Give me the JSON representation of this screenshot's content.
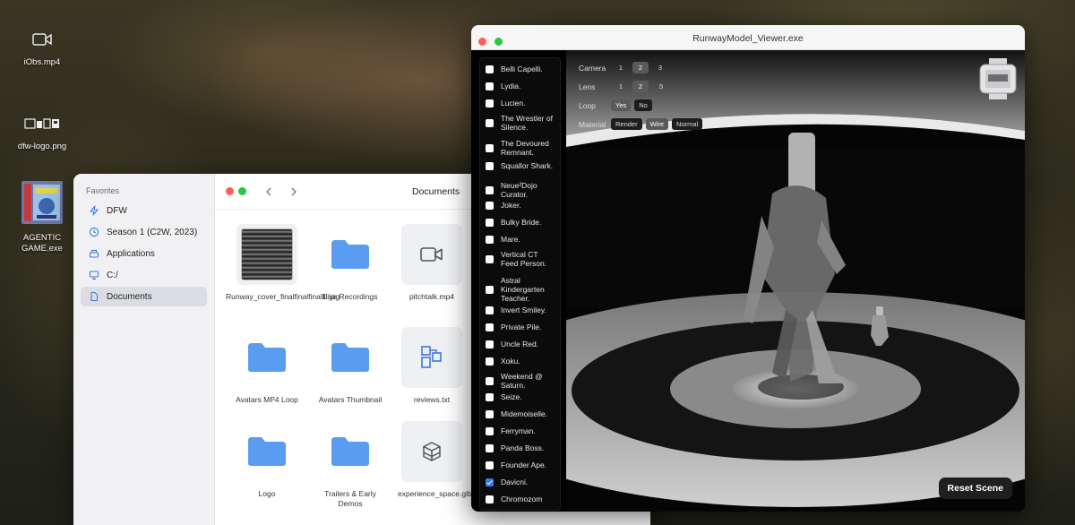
{
  "desktop": {
    "icons": [
      {
        "label": "iObs.mp4",
        "icon": "video-icon"
      },
      {
        "label": "dfw-logo.png",
        "icon": "logo-image-icon"
      },
      {
        "label": "AGENTIC GAME.exe",
        "icon": "game-cartridge-icon"
      }
    ]
  },
  "file_manager": {
    "sidebar_heading": "Favorites",
    "sidebar_items": [
      {
        "label": "DFW",
        "icon": "bolt-icon"
      },
      {
        "label": "Season 1 (C2W, 2023)",
        "icon": "clock-icon"
      },
      {
        "label": "Applications",
        "icon": "apps-icon"
      },
      {
        "label": "C:/",
        "icon": "monitor-icon"
      },
      {
        "label": "Documents",
        "icon": "document-icon",
        "active": true
      }
    ],
    "title": "Documents",
    "files": [
      {
        "label": "Runway_cover_finalfinalfinallll.jpg",
        "icon": "image-thumbnail"
      },
      {
        "label": "Live Recordings",
        "icon": "folder-icon"
      },
      {
        "label": "pitchtalk.mp4",
        "icon": "video-icon"
      },
      {
        "label": "Avatars MP4 Loop",
        "icon": "folder-icon"
      },
      {
        "label": "Avatars Thumbnail",
        "icon": "folder-icon"
      },
      {
        "label": "reviews.txt",
        "icon": "text-file-icon"
      },
      {
        "label": "Logo",
        "icon": "folder-icon"
      },
      {
        "label": "Trailers & Early Demos",
        "icon": "folder-icon"
      },
      {
        "label": "experience_space.glb",
        "icon": "3d-model-icon"
      }
    ]
  },
  "viewer": {
    "title": "RunwayModel_Viewer.exe",
    "characters": [
      {
        "label": "Belli Capelli.",
        "checked": false
      },
      {
        "label": "Lydia.",
        "checked": false
      },
      {
        "label": "Lucien.",
        "checked": false
      },
      {
        "label": "The Wrestler of Silence.",
        "checked": false
      },
      {
        "label": "The Devoured Remnant.",
        "checked": false
      },
      {
        "label": "Squallor Shark.",
        "checked": false
      },
      {
        "label": "Neue²Dojo Curator.",
        "checked": false
      },
      {
        "label": "Joker.",
        "checked": false
      },
      {
        "label": "Bulky Bride.",
        "checked": false
      },
      {
        "label": "Mare.",
        "checked": false
      },
      {
        "label": "Vertical CT Feed Person.",
        "checked": false
      },
      {
        "label": "Astral Kindergarten Teacher.",
        "checked": false
      },
      {
        "label": "Invert Smiley.",
        "checked": false
      },
      {
        "label": "Private Pile.",
        "checked": false
      },
      {
        "label": "Uncle Red.",
        "checked": false
      },
      {
        "label": "Xoku.",
        "checked": false
      },
      {
        "label": "Weekend @ Saturn.",
        "checked": false
      },
      {
        "label": "Seize.",
        "checked": false
      },
      {
        "label": "Midemoiselle.",
        "checked": false
      },
      {
        "label": "Ferryman.",
        "checked": false
      },
      {
        "label": "Panda Boss.",
        "checked": false
      },
      {
        "label": "Founder Ape.",
        "checked": false
      },
      {
        "label": "Davicni.",
        "checked": true
      },
      {
        "label": "Chromozom",
        "checked": false
      }
    ],
    "controls": {
      "camera": {
        "label": "Camera",
        "options": [
          "1",
          "2",
          "3"
        ],
        "selected": "2"
      },
      "lens": {
        "label": "Lens",
        "options": [
          "1",
          "2",
          ".5"
        ],
        "selected": "2"
      },
      "loop": {
        "label": "Loop",
        "options": [
          "Yes",
          "No"
        ],
        "selected": "Yes"
      },
      "material": {
        "label": "Material",
        "options": [
          "Render",
          "Wire",
          "Normal"
        ],
        "selected": "Wire"
      }
    },
    "reset_label": "Reset Scene"
  },
  "colors": {
    "folder": "#5a9cf0",
    "accent_check": "#2f7bf5",
    "window_red": "#ff5f57",
    "window_green": "#28c840"
  }
}
